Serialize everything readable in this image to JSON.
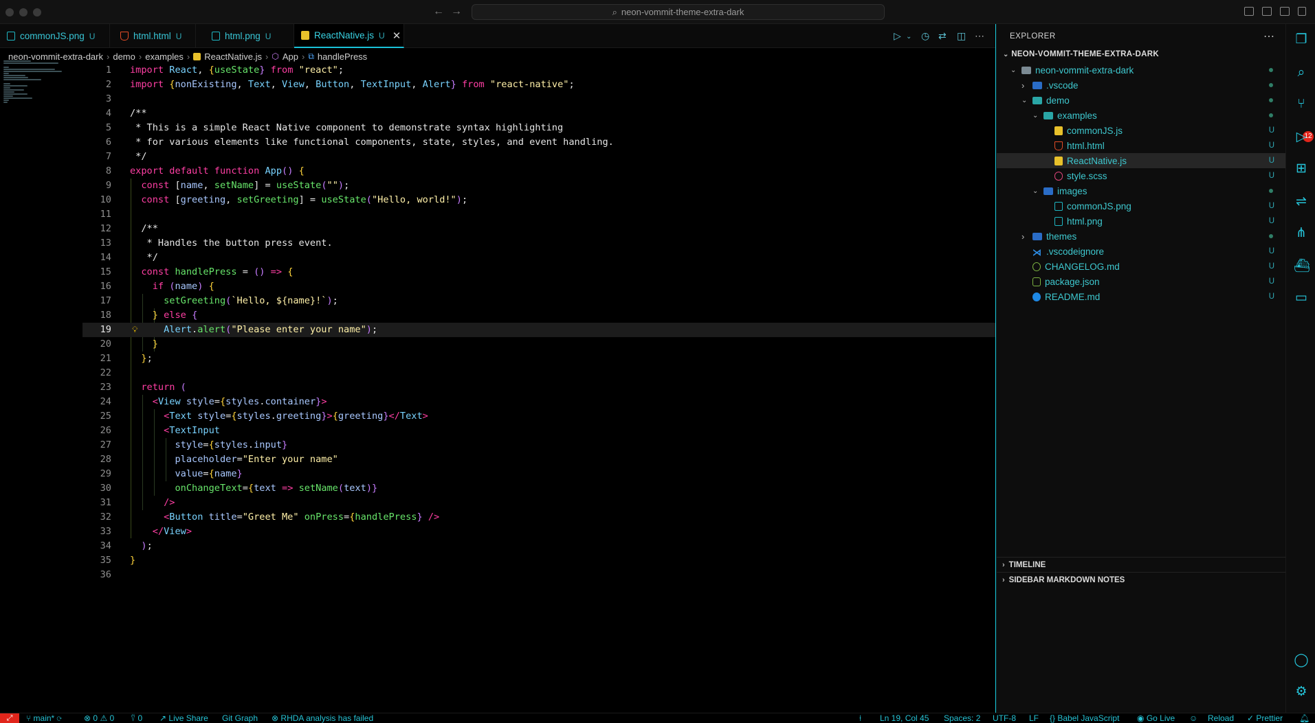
{
  "titlebar": {
    "search": "neon-vommit-theme-extra-dark"
  },
  "tabs": [
    {
      "label": "commonJS.png",
      "status": "U",
      "icon": "image-file-icon"
    },
    {
      "label": "html.html",
      "status": "U",
      "icon": "html-file-icon"
    },
    {
      "label": "html.png",
      "status": "U",
      "icon": "image-file-icon"
    },
    {
      "label": "ReactNative.js",
      "status": "U",
      "icon": "js-file-icon",
      "active": true
    }
  ],
  "breadcrumb": [
    "neon-vommit-extra-dark",
    "demo",
    "examples",
    "ReactNative.js",
    "App",
    "handlePress"
  ],
  "editor": {
    "current_line": 19,
    "lines": [
      "import React, {useState} from \"react\";",
      "import {nonExisting, Text, View, Button, TextInput, Alert} from \"react-native\";",
      "",
      "/**",
      " * This is a simple React Native component to demonstrate syntax highlighting",
      " * for various elements like functional components, state, styles, and event handling.",
      " */",
      "export default function App() {",
      "  const [name, setName] = useState(\"\");",
      "  const [greeting, setGreeting] = useState(\"Hello, world!\");",
      "",
      "  /**",
      "   * Handles the button press event.",
      "   */",
      "  const handlePress = () => {",
      "    if (name) {",
      "      setGreeting(`Hello, ${name}!`);",
      "    } else {",
      "      Alert.alert(\"Please enter your name\");",
      "    }",
      "  };",
      "",
      "  return (",
      "    <View style={styles.container}>",
      "      <Text style={styles.greeting}>{greeting}</Text>",
      "      <TextInput",
      "        style={styles.input}",
      "        placeholder=\"Enter your name\"",
      "        value={name}",
      "        onChangeText={text => setName(text)}",
      "      />",
      "      <Button title=\"Greet Me\" onPress={handlePress} />",
      "    </View>",
      "  );",
      "}",
      ""
    ]
  },
  "sidebar": {
    "title": "EXPLORER",
    "root": "NEON-VOMMIT-THEME-EXTRA-DARK",
    "tree": [
      {
        "label": "neon-vommit-extra-dark",
        "depth": 1,
        "kind": "folder-open",
        "status": "dot"
      },
      {
        "label": ".vscode",
        "depth": 2,
        "kind": "folder-closed",
        "status": "dot"
      },
      {
        "label": "demo",
        "depth": 2,
        "kind": "folder-open",
        "status": "dot"
      },
      {
        "label": "examples",
        "depth": 3,
        "kind": "folder-open",
        "status": "dot"
      },
      {
        "label": "commonJS.js",
        "depth": 4,
        "kind": "js",
        "status": "U"
      },
      {
        "label": "html.html",
        "depth": 4,
        "kind": "html",
        "status": "U"
      },
      {
        "label": "ReactNative.js",
        "depth": 4,
        "kind": "js",
        "status": "U",
        "selected": true
      },
      {
        "label": "style.scss",
        "depth": 4,
        "kind": "scss",
        "status": "U"
      },
      {
        "label": "images",
        "depth": 3,
        "kind": "folder-open",
        "status": "dot"
      },
      {
        "label": "commonJS.png",
        "depth": 4,
        "kind": "img",
        "status": "U"
      },
      {
        "label": "html.png",
        "depth": 4,
        "kind": "img",
        "status": "U"
      },
      {
        "label": "themes",
        "depth": 2,
        "kind": "folder-closed",
        "status": "dot"
      },
      {
        "label": ".vscodeignore",
        "depth": 2,
        "kind": "vsc",
        "status": "U"
      },
      {
        "label": "CHANGELOG.md",
        "depth": 2,
        "kind": "log",
        "status": "U"
      },
      {
        "label": "package.json",
        "depth": 2,
        "kind": "json",
        "status": "U"
      },
      {
        "label": "README.md",
        "depth": 2,
        "kind": "md",
        "status": "U"
      }
    ],
    "sections": [
      "TIMELINE",
      "SIDEBAR MARKDOWN NOTES"
    ]
  },
  "activity": {
    "scm_badge": "12"
  },
  "statusbar": {
    "branch": "main*",
    "errors": "0",
    "warnings": "0",
    "ports": "0",
    "live_share": "Live Share",
    "git_graph": "Git Graph",
    "rhda": "RHDA analysis has failed",
    "position": "Ln 19, Col 45",
    "spaces": "Spaces: 2",
    "encoding": "UTF-8",
    "eol": "LF",
    "language": "Babel JavaScript",
    "go_live": "Go Live",
    "reload": "Reload",
    "prettier": "Prettier"
  },
  "colors": {
    "accent": "#19c1d8",
    "keyword": "#ff3fa4",
    "string": "#fff0a8",
    "function": "#68e66b",
    "badge": "#e1251b"
  }
}
